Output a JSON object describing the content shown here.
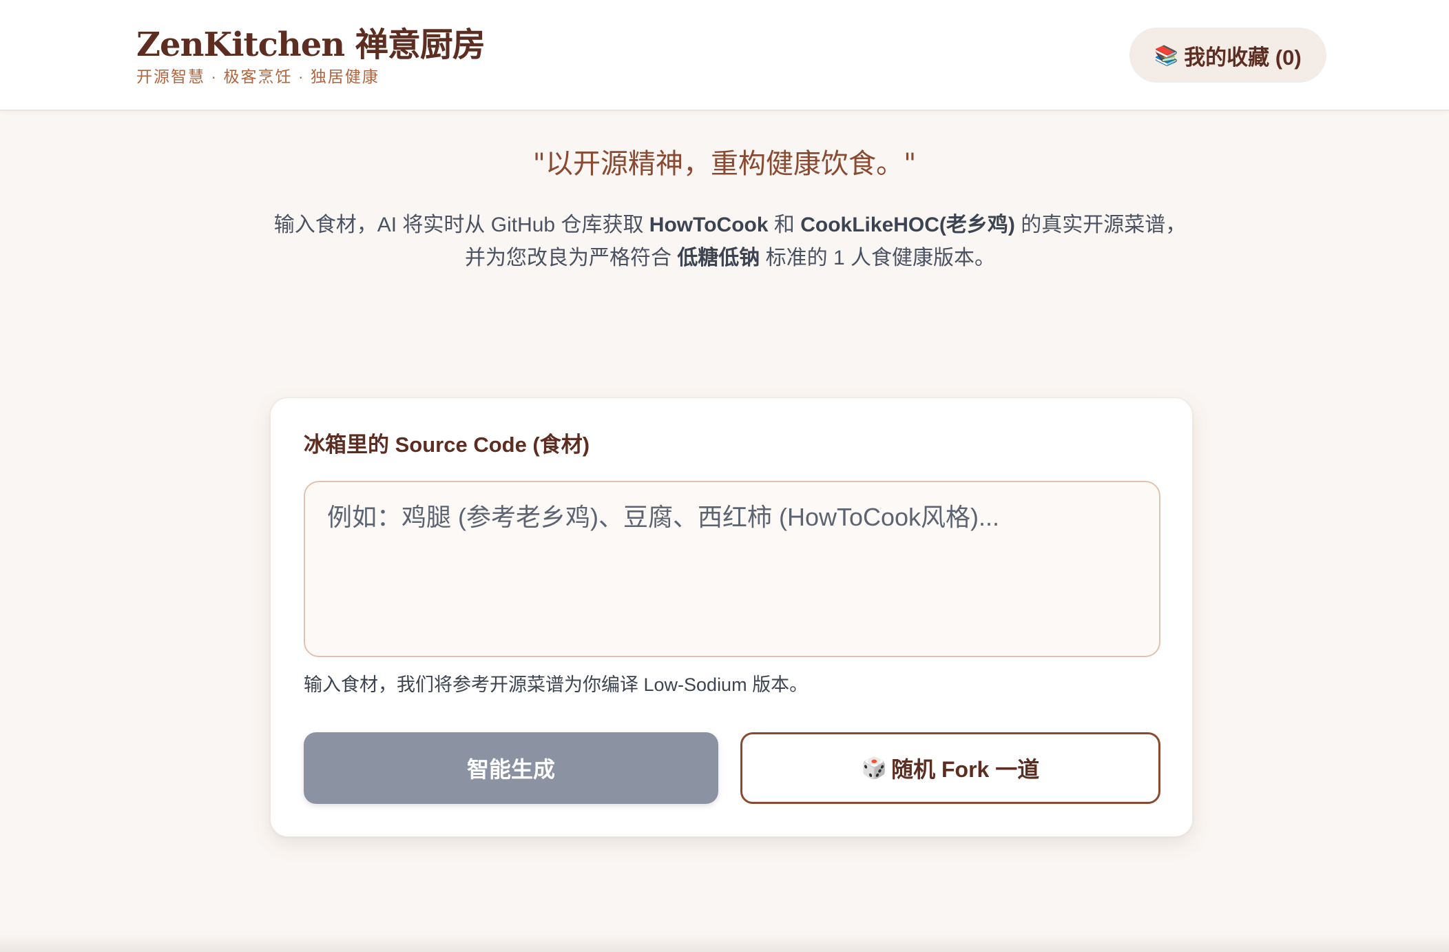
{
  "header": {
    "title": "ZenKitchen 禅意厨房",
    "subtitle": "开源智慧 · 极客烹饪 · 独居健康",
    "favorites": {
      "icon": "books-icon",
      "icon_glyph": "📚",
      "label": "我的收藏 (0)"
    }
  },
  "hero": {
    "motto": "\"以开源精神，重构健康饮食。\"",
    "intro_line1_pre": "输入食材，AI 将实时从 GitHub 仓库获取 ",
    "intro_repo1": "HowToCook",
    "intro_and": " 和 ",
    "intro_repo2": "CookLikeHOC(老乡鸡)",
    "intro_line1_post": " 的真实开源菜谱，",
    "intro_line2_pre": "并为您改良为严格符合 ",
    "intro_highlight": "低糖低钠",
    "intro_line2_post": " 标准的 1 人食健康版本。"
  },
  "form": {
    "label": "冰箱里的 Source Code (食材)",
    "textarea_value": "",
    "textarea_placeholder": "例如：鸡腿 (参考老乡鸡)、豆腐、西红柿 (HowToCook风格)...",
    "hint": "输入食材，我们将参考开源菜谱为你编译 Low-Sodium 版本。",
    "generate_label": "智能生成",
    "fork_icon": "dice-icon",
    "fork_icon_glyph": "🎲",
    "fork_label": "随机 Fork 一道"
  },
  "colors": {
    "brand_brown": "#5c2d20",
    "accent_orange": "#b0643f",
    "background": "#faf6f3",
    "disabled_button": "#8b93a3"
  }
}
